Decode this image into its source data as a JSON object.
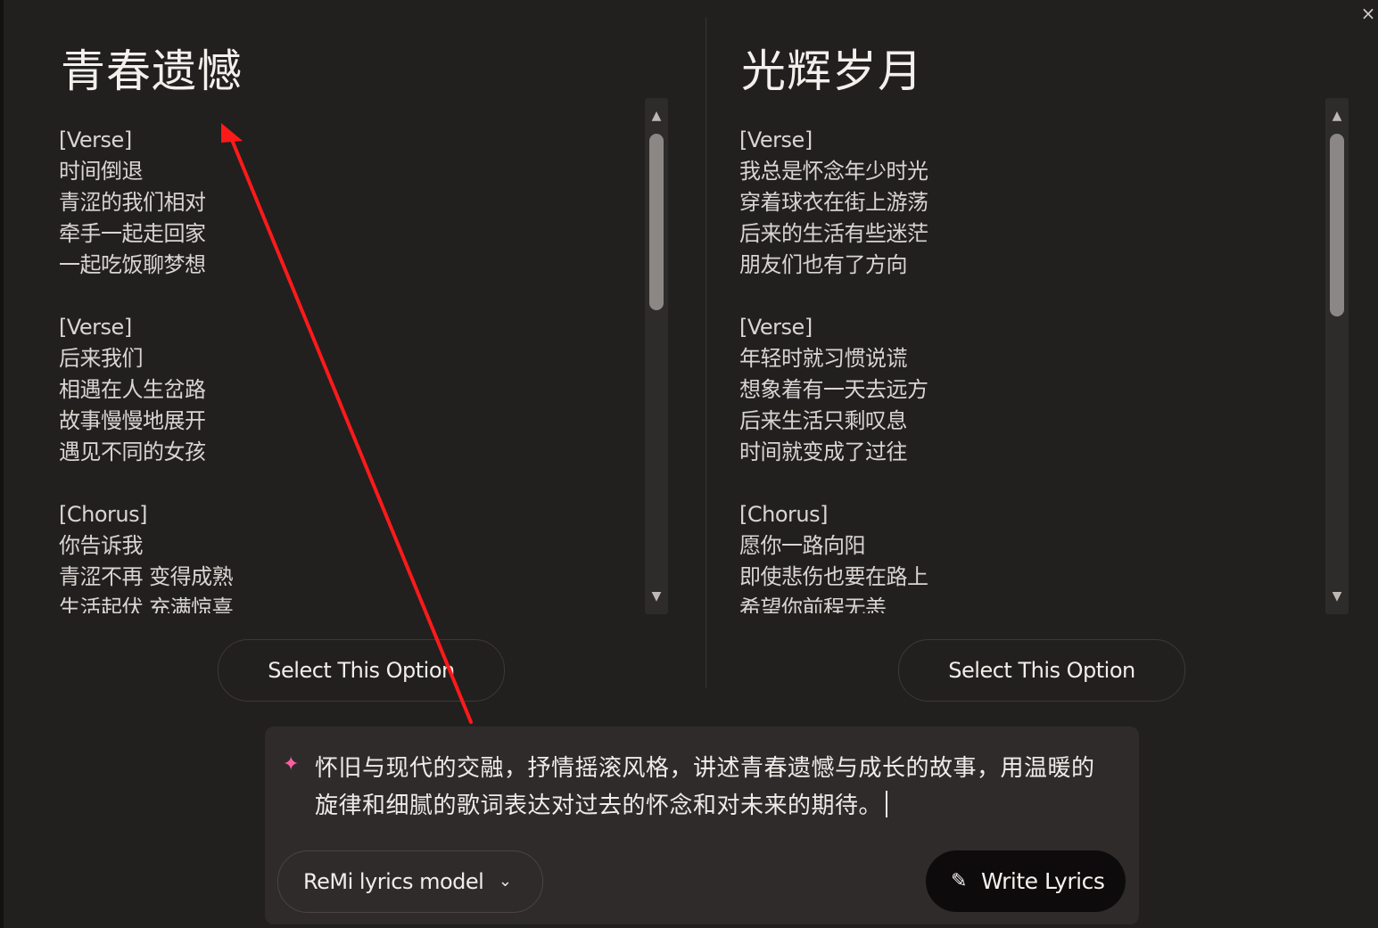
{
  "close_icon": "×",
  "options": [
    {
      "title": "青春遗憾",
      "lyrics": "[Verse]\n时间倒退\n青涩的我们相对\n牵手一起走回家\n一起吃饭聊梦想\n\n[Verse]\n后来我们\n相遇在人生岔路\n故事慢慢地展开\n遇见不同的女孩\n\n[Chorus]\n你告诉我\n青涩不再 变得成熟\n生活起伏 充满惊喜",
      "select_label": "Select This Option"
    },
    {
      "title": "光辉岁月",
      "lyrics": "[Verse]\n我总是怀念年少时光\n穿着球衣在街上游荡\n后来的生活有些迷茫\n朋友们也有了方向\n\n[Verse]\n年轻时就习惯说谎\n想象着有一天去远方\n后来生活只剩叹息\n时间就变成了过往\n\n[Chorus]\n愿你一路向阳\n即使悲伤也要在路上\n希望你前程无恙",
      "select_label": "Select This Option"
    }
  ],
  "prompt": {
    "text": "怀旧与现代的交融，抒情摇滚风格，讲述青春遗憾与成长的故事，用温暖的旋律和细腻的歌词表达对过去的怀念和对未来的期待。",
    "model_label": "ReMi lyrics model",
    "write_label": "Write Lyrics"
  },
  "colors": {
    "background": "#221f1f",
    "panel": "#2f2b2b",
    "sparkle": "#ff5da2",
    "annotation_arrow": "#ff1a1a"
  }
}
